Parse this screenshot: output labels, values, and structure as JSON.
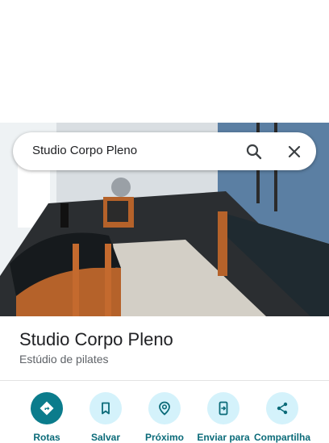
{
  "search": {
    "query": "Studio Corpo Pleno",
    "search_icon": "search-icon",
    "close_icon": "close-icon"
  },
  "photo": {
    "subject": "studio-photo"
  },
  "place": {
    "name": "Studio Corpo Pleno",
    "category": "Estúdio de pilates"
  },
  "actions": [
    {
      "label": "Rotas",
      "icon": "directions-icon"
    },
    {
      "label": "Salvar",
      "icon": "bookmark-icon"
    },
    {
      "label": "Próximo",
      "icon": "nearby-icon"
    },
    {
      "label": "Enviar para",
      "icon": "send-to-phone-icon"
    },
    {
      "label": "Compartilha",
      "icon": "share-icon"
    }
  ],
  "colors": {
    "primary_action": "#0b7c8c",
    "secondary_action_bg": "#d4f2fb",
    "action_text": "#0b6b79"
  }
}
